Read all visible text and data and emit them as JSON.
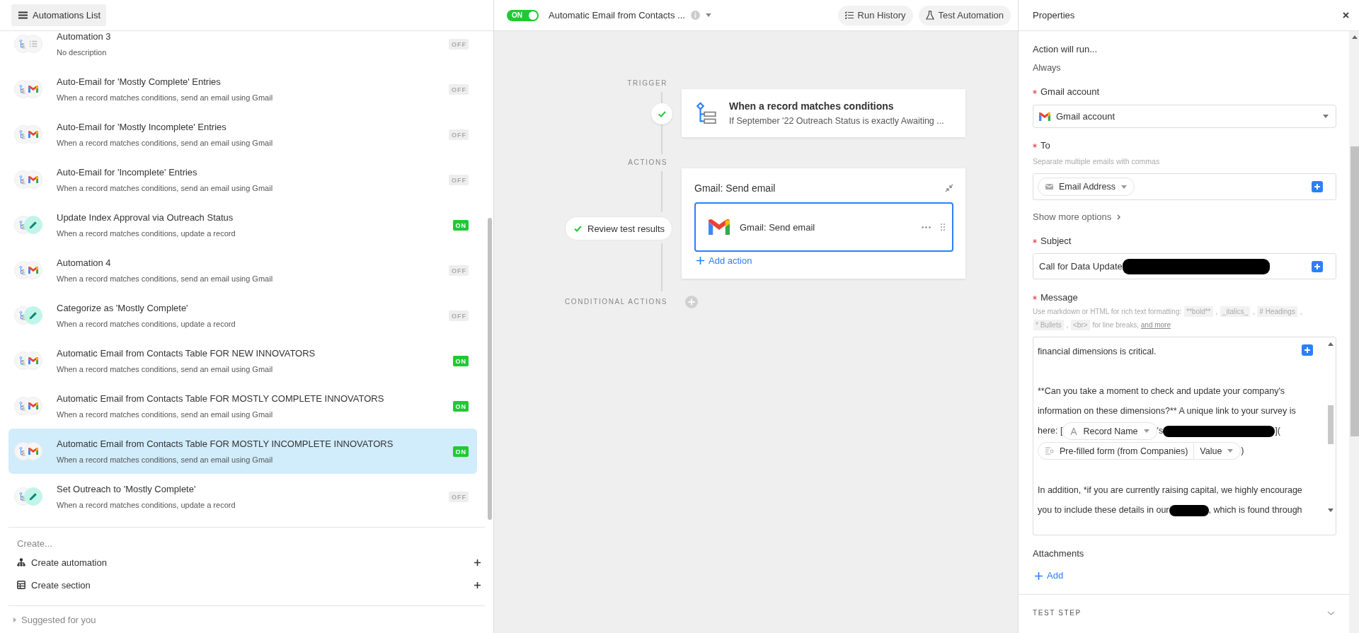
{
  "sidebar": {
    "title": "Automations List",
    "automations": [
      {
        "title": "Automation 3",
        "description": "No description",
        "kind": "none",
        "status": "OFF",
        "on": false,
        "selected": false
      },
      {
        "title": "Auto-Email for 'Mostly Complete' Entries",
        "description": "When a record matches conditions, send an email using Gmail",
        "kind": "gmail",
        "status": "OFF",
        "on": false,
        "selected": false
      },
      {
        "title": "Auto-Email for 'Mostly Incomplete' Entries",
        "description": "When a record matches conditions, send an email using Gmail",
        "kind": "gmail",
        "status": "OFF",
        "on": false,
        "selected": false
      },
      {
        "title": "Auto-Email for 'Incomplete' Entries",
        "description": "When a record matches conditions, send an email using Gmail",
        "kind": "gmail",
        "status": "OFF",
        "on": false,
        "selected": false
      },
      {
        "title": "Update Index Approval via Outreach Status",
        "description": "When a record matches conditions, update a record",
        "kind": "update",
        "status": "ON",
        "on": true,
        "selected": false
      },
      {
        "title": "Automation 4",
        "description": "When a record matches conditions, send an email using Gmail",
        "kind": "gmail",
        "status": "OFF",
        "on": false,
        "selected": false
      },
      {
        "title": "Categorize as 'Mostly Complete'",
        "description": "When a record matches conditions, update a record",
        "kind": "update",
        "status": "OFF",
        "on": false,
        "selected": false
      },
      {
        "title": "Automatic Email from Contacts Table FOR NEW INNOVATORS",
        "description": "When a record matches conditions, send an email using Gmail",
        "kind": "gmail",
        "status": "ON",
        "on": true,
        "selected": false
      },
      {
        "title": "Automatic Email from Contacts Table FOR MOSTLY COMPLETE INNOVATORS",
        "description": "When a record matches conditions, send an email using Gmail",
        "kind": "gmail",
        "status": "ON",
        "on": true,
        "selected": false
      },
      {
        "title": "Automatic Email from Contacts Table FOR MOSTLY INCOMPLETE INNOVATORS",
        "description": "When a record matches conditions, send an email using Gmail",
        "kind": "gmail",
        "status": "ON",
        "on": true,
        "selected": true
      },
      {
        "title": "Set Outreach to 'Mostly Complete'",
        "description": "When a record matches conditions, update a record",
        "kind": "update",
        "status": "OFF",
        "on": false,
        "selected": false
      }
    ],
    "create_heading": "Create...",
    "create_items": [
      {
        "label": "Create automation"
      },
      {
        "label": "Create section"
      }
    ],
    "suggested": "Suggested for you"
  },
  "editor": {
    "toggle": {
      "label": "ON",
      "on": true
    },
    "title": "Automatic Email from Contacts ...",
    "buttons": [
      {
        "label": "Run History"
      },
      {
        "label": "Test Automation"
      }
    ],
    "trigger_label": "TRIGGER",
    "trigger": {
      "title": "When a record matches conditions",
      "summary": "If September '22 Outreach Status is exactly Awaiting ..."
    },
    "actions_label": "ACTIONS",
    "action_group": {
      "title": "Gmail: Send email",
      "step": "Gmail: Send email",
      "add": "Add action"
    },
    "review_button": "Review test results",
    "conditional_label": "CONDITIONAL ACTIONS"
  },
  "properties": {
    "title": "Properties",
    "run_label": "Action will run...",
    "run_value": "Always",
    "account": {
      "label": "Gmail account",
      "required": true,
      "value": "Gmail account"
    },
    "to": {
      "label": "To",
      "required": true,
      "hint": "Separate multiple emails with commas",
      "token": "Email Address"
    },
    "more_options": "Show more options",
    "subject": {
      "label": "Subject",
      "required": true,
      "value": "Call for Data Update",
      "redacted": true
    },
    "message": {
      "label": "Message",
      "required": true,
      "hint": [
        [
          {
            "kind": "text",
            "text": "Use markdown or HTML for rich text formatting:"
          },
          {
            "kind": "code",
            "text": "**bold**"
          },
          {
            "kind": "text",
            "text": ","
          },
          {
            "kind": "code",
            "text": "_italics_"
          },
          {
            "kind": "text",
            "text": ","
          },
          {
            "kind": "code",
            "text": "# Headings"
          },
          {
            "kind": "text",
            "text": ","
          }
        ],
        [
          {
            "kind": "code",
            "text": "* Bullets"
          },
          {
            "kind": "text",
            "text": ","
          },
          {
            "kind": "code",
            "text": "<br>"
          },
          {
            "kind": "text",
            "text": "for line breaks,"
          },
          {
            "kind": "link",
            "text": "and more"
          }
        ]
      ],
      "paragraphs": [
        [
          [
            {
              "kind": "text",
              "text": "financial dimensions is critical."
            }
          ]
        ],
        [
          [
            {
              "kind": "text",
              "text": "**Can you take a moment to check and update your company's"
            }
          ],
          [
            {
              "kind": "text",
              "text": "information on these dimensions?** A unique link to your survey is"
            }
          ],
          [
            {
              "kind": "text",
              "text": "here: ["
            },
            {
              "kind": "token",
              "text": "Record Name"
            },
            {
              "kind": "text",
              "text": "'s"
            },
            {
              "kind": "redacted"
            },
            {
              "kind": "text",
              "text": "]("
            }
          ],
          [
            {
              "kind": "lookup",
              "text": "Pre-filled form (from Companies)",
              "value": "Value"
            },
            {
              "kind": "text",
              "text": ")"
            }
          ]
        ],
        [
          [
            {
              "kind": "text",
              "text": "In addition, *if you are currently raising capital, we highly encourage"
            }
          ],
          [
            {
              "kind": "text",
              "text": "you to include these details in our"
            },
            {
              "kind": "redacted"
            },
            {
              "kind": "text",
              "text": ", which is found through"
            }
          ]
        ]
      ]
    },
    "attachments": {
      "label": "Attachments",
      "add": "Add"
    },
    "test_step": "TEST STEP"
  }
}
